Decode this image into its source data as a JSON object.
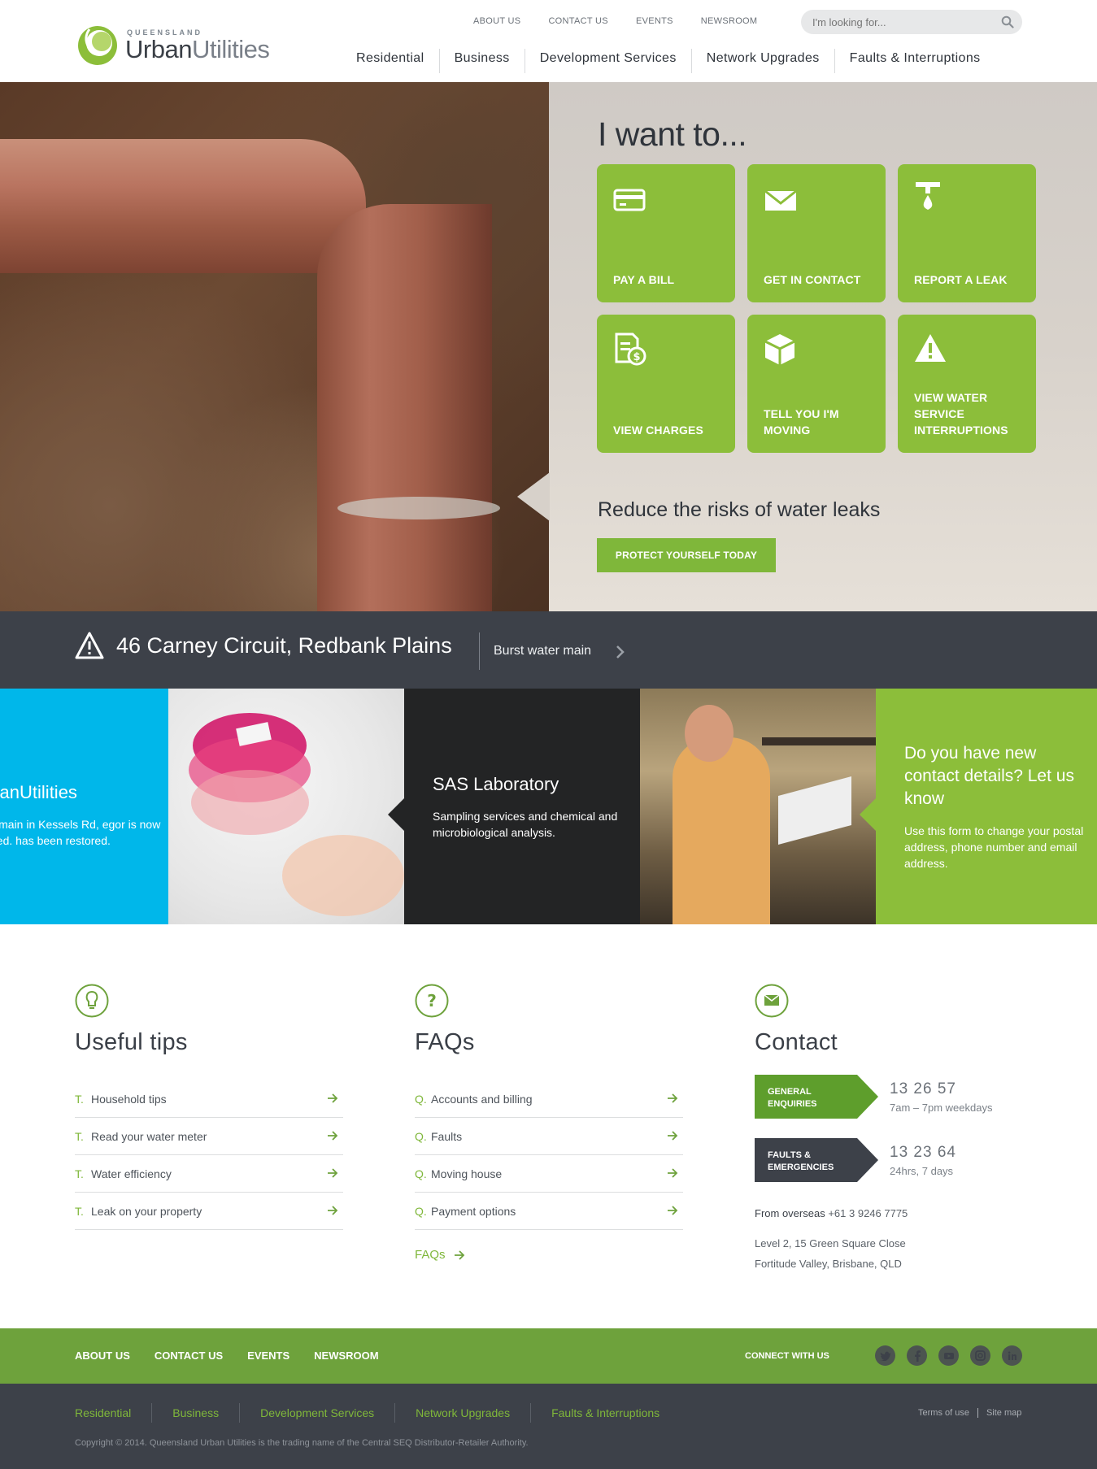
{
  "brand": {
    "small": "QUEENSLAND",
    "big_dark": "Urban",
    "big_light": "Utilities"
  },
  "top_links": [
    "ABOUT US",
    "CONTACT US",
    "EVENTS",
    "NEWSROOM"
  ],
  "search": {
    "placeholder": "I'm looking for..."
  },
  "main_nav": [
    "Residential",
    "Business",
    "Development Services",
    "Network Upgrades",
    "Faults & Interruptions"
  ],
  "hero": {
    "heading": "I want to...",
    "tiles": [
      {
        "label": "PAY A BILL",
        "icon": "card-icon"
      },
      {
        "label": "GET IN CONTACT",
        "icon": "envelope-icon"
      },
      {
        "label": "REPORT A LEAK",
        "icon": "tap-drop-icon"
      },
      {
        "label": "VIEW CHARGES",
        "icon": "bill-dollar-icon"
      },
      {
        "label": "TELL YOU I'M MOVING",
        "icon": "box-icon"
      },
      {
        "label": "VIEW WATER SERVICE INTERRUPTIONS",
        "icon": "warning-icon"
      }
    ],
    "promo_title": "Reduce the risks of water leaks",
    "promo_button": "PROTECT YOURSELF TODAY"
  },
  "alert": {
    "location": "46 Carney Circuit, Redbank Plains",
    "description": "Burst water main"
  },
  "features": {
    "blue": {
      "title": "rbanUtilities",
      "text": "water main in Kessels Rd, egor is now repaired. has been restored."
    },
    "dark": {
      "title": "SAS Laboratory",
      "text": "Sampling services and chemical and microbiological analysis."
    },
    "green": {
      "title": "Do you have new contact details? Let us know",
      "text": "Use this form to change your postal address, phone number and email address."
    }
  },
  "tips": {
    "title": "Useful tips",
    "prefix": "T.",
    "items": [
      "Household tips",
      "Read your water meter",
      "Water efficiency",
      "Leak on your property"
    ]
  },
  "faqs": {
    "title": "FAQs",
    "prefix": "Q.",
    "items": [
      "Accounts and billing",
      "Faults",
      "Moving house",
      "Payment options"
    ],
    "more": "FAQs"
  },
  "contact": {
    "title": "Contact",
    "general": {
      "tag_line1": "GENERAL",
      "tag_line2": "ENQUIRIES",
      "number": "13 26 57",
      "hours": "7am – 7pm weekdays"
    },
    "faults": {
      "tag_line1": "FAULTS &",
      "tag_line2": "EMERGENCIES",
      "number": "13 23 64",
      "hours": "24hrs, 7 days"
    },
    "overseas_label": "From overseas",
    "overseas_number": "+61 3 9246 7775",
    "address_line1": "Level 2, 15 Green Square Close",
    "address_line2": "Fortitude Valley, Brisbane, QLD"
  },
  "footer": {
    "links": [
      "ABOUT US",
      "CONTACT US",
      "EVENTS",
      "NEWSROOM"
    ],
    "connect": "CONNECT WITH US",
    "socials": [
      "twitter-icon",
      "facebook-icon",
      "youtube-icon",
      "instagram-icon",
      "linkedin-icon"
    ],
    "nav": [
      "Residential",
      "Business",
      "Development Services",
      "Network Upgrades",
      "Faults & Interruptions"
    ],
    "terms": "Terms of use",
    "sitemap": "Site map",
    "copyright": "Copyright © 2014. Queensland Urban Utilities is the trading name of the Central SEQ Distributor-Retailer Authority."
  },
  "colors": {
    "green": "#8cbe3a",
    "dark_green": "#6ea23c",
    "charcoal": "#3d4149",
    "blue": "#00b7ea"
  }
}
